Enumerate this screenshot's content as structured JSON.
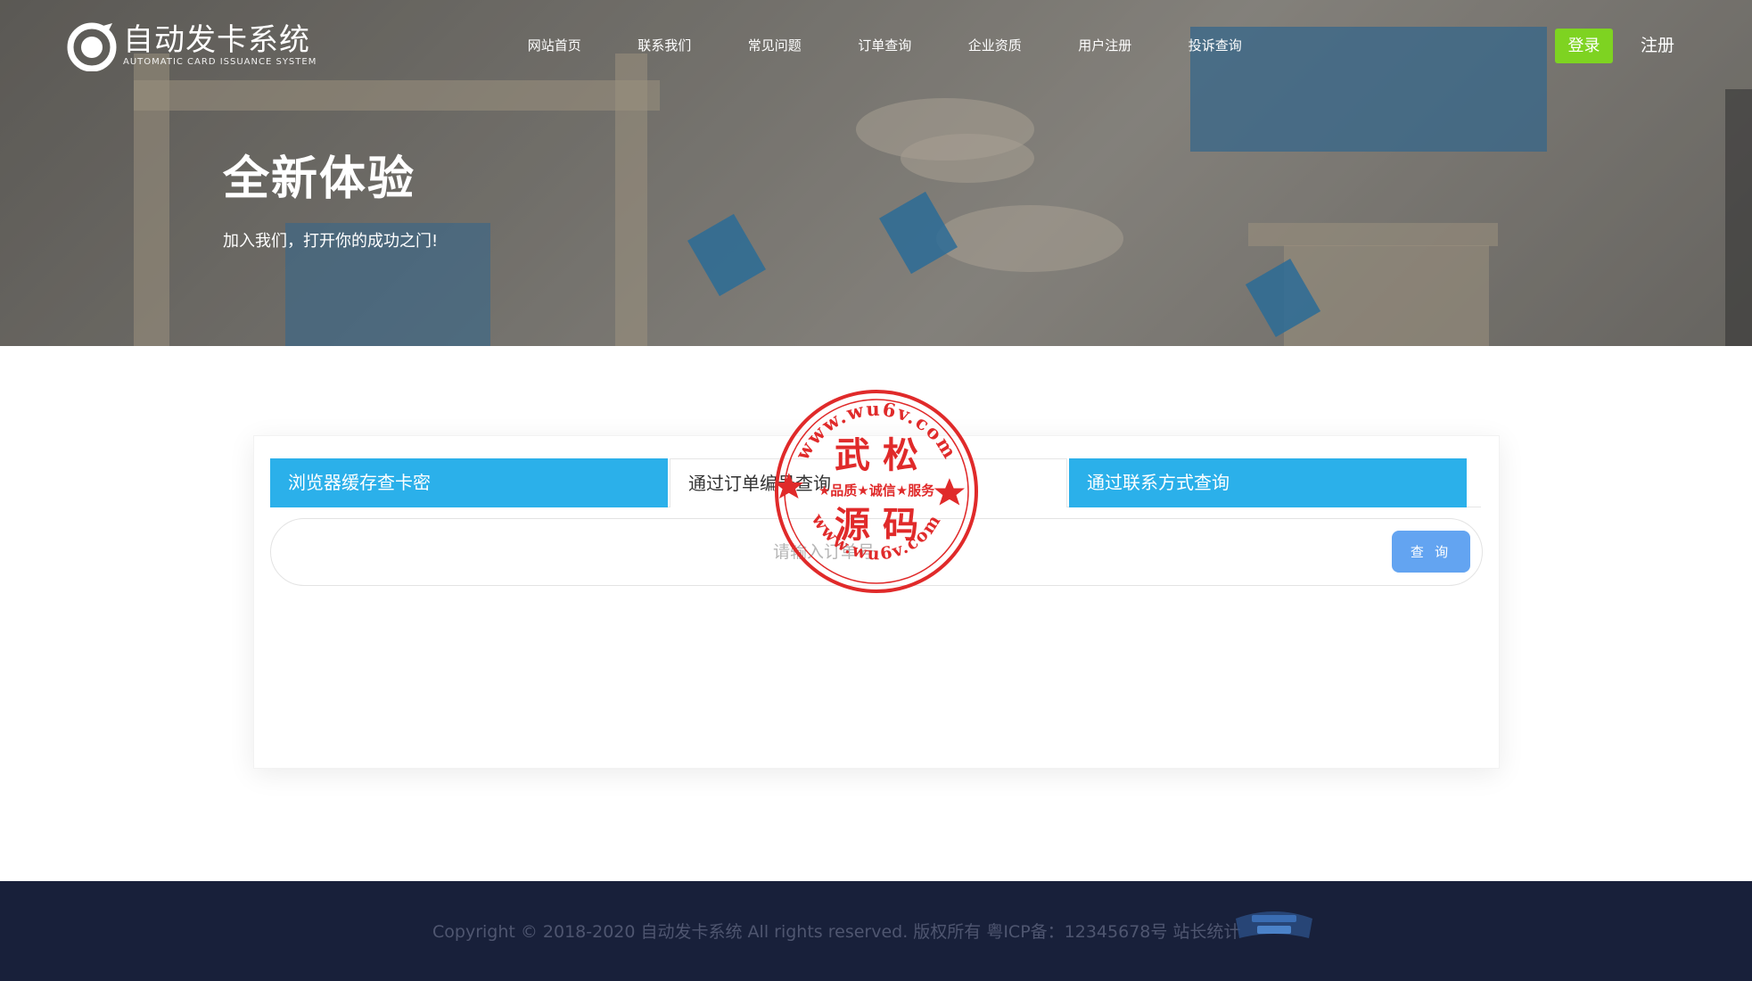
{
  "brand": {
    "name": "自动发卡系统",
    "subtitle": "AUTOMATIC CARD ISSUANCE SYSTEM"
  },
  "nav": {
    "items": [
      "网站首页",
      "联系我们",
      "常见问题",
      "订单查询",
      "企业资质",
      "用户注册",
      "投诉查询"
    ],
    "login": "登录",
    "register": "注册"
  },
  "hero": {
    "title": "全新体验",
    "subtitle": "加入我们，打开你的成功之门!"
  },
  "query": {
    "tabs": [
      {
        "label": "浏览器缓存查卡密",
        "active": true
      },
      {
        "label": "通过订单编号查询",
        "active": false
      },
      {
        "label": "通过联系方式查询",
        "active": true
      }
    ],
    "placeholder": "请输入订单号",
    "button": "查 询"
  },
  "stamp": {
    "url_top": "www.wu6v.com",
    "url_bottom": "www.wu6v.com",
    "line1": "武 松",
    "line2": "★品质★诚信★服务",
    "line3": "源 码"
  },
  "footer": {
    "copyright": "Copyright © 2018-2020 自动发卡系统 All rights reserved. 版权所有 粤ICP备：12345678号 站长统计"
  },
  "colors": {
    "tab_active": "#2bb0ea",
    "login_button": "#7ed321",
    "query_button": "#63a4f1",
    "footer_bg": "#18203a",
    "stamp_red": "#e02a2a"
  }
}
